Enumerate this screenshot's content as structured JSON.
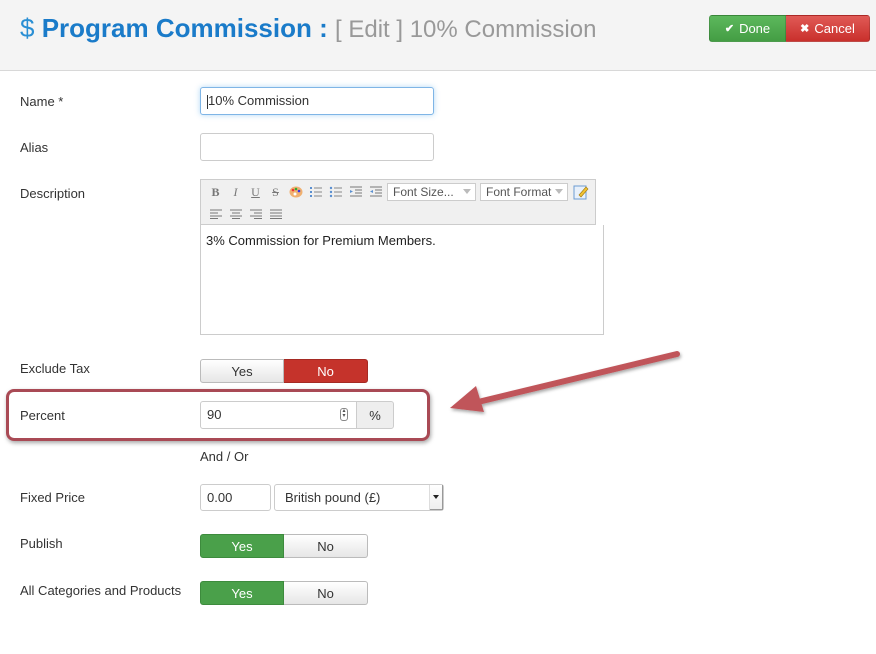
{
  "header": {
    "icon": "dollar-icon",
    "icon_glyph": "$",
    "title": "Program Commission :",
    "subtitle": "[ Edit ] 10% Commission",
    "done_label": "Done",
    "done_icon": "✔",
    "cancel_label": "Cancel",
    "cancel_icon": "✖",
    "colors": {
      "title": "#1a7bc9",
      "done": "#4cae4c",
      "cancel": "#d9403b"
    }
  },
  "form": {
    "name": {
      "label": "Name *",
      "value": "10% Commission"
    },
    "alias": {
      "label": "Alias",
      "value": ""
    },
    "description": {
      "label": "Description",
      "toolbar": {
        "buttons": [
          "B",
          "I",
          "U",
          "S"
        ],
        "font_size": "Font Size...",
        "font_format": "Font Format"
      },
      "value": "3% Commission for Premium Members."
    },
    "exclude_tax": {
      "label": "Exclude Tax",
      "yes": "Yes",
      "no": "No",
      "selected": "No"
    },
    "percent": {
      "label": "Percent",
      "value": "90",
      "addon": "%"
    },
    "and_or": "And / Or",
    "fixed_price": {
      "label": "Fixed Price",
      "value": "0.00",
      "currency": "British pound (£)"
    },
    "publish": {
      "label": "Publish",
      "yes": "Yes",
      "no": "No",
      "selected": "Yes"
    },
    "all_categories": {
      "label": "All Categories and Products",
      "yes": "Yes",
      "no": "No",
      "selected": "Yes"
    }
  },
  "annotation": {
    "color": "#a94a55"
  }
}
